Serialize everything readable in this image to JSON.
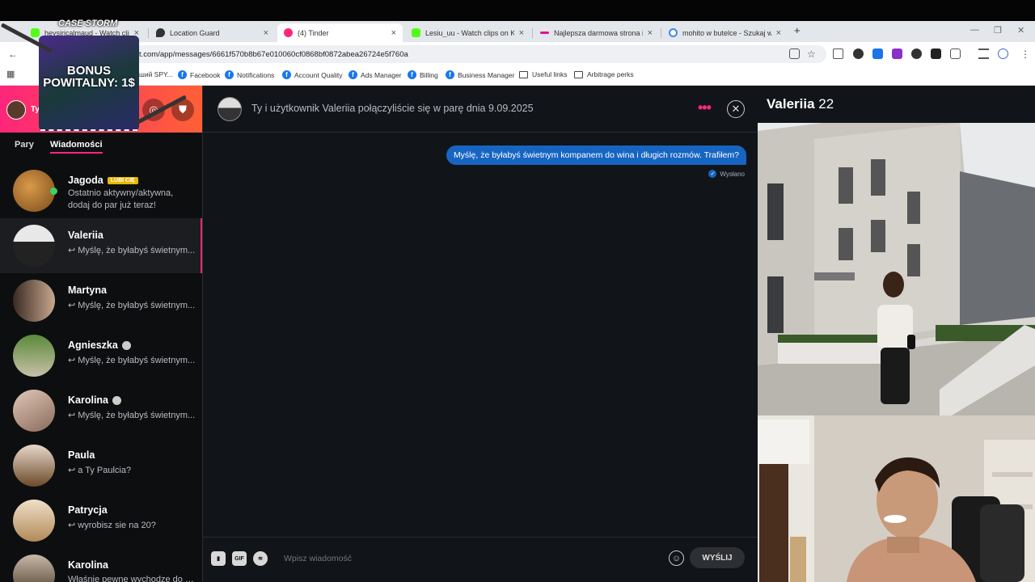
{
  "browser": {
    "tabs": [
      {
        "title": "heysiricalmaud - Watch clips",
        "color": "#53fc18"
      },
      {
        "title": "Location Guard",
        "color": "#333333"
      },
      {
        "title": "(4) Tinder",
        "color": "#fd267a"
      },
      {
        "title": "Lesiu_uu - Watch clips on Kick",
        "color": "#53fc18"
      },
      {
        "title": "Najlepsza darmowa strona i ap",
        "color": "#e0109a"
      },
      {
        "title": "mohito w butelce - Szukaj w Go",
        "color": "#4285f4"
      }
    ],
    "url": "t.com/app/messages/6661f570b8b67e010060cf0868bf0872abea26724e5f760a",
    "bookmarks": [
      {
        "label": "ший SPY...",
        "icon": "generic-icon"
      },
      {
        "label": "Facebook",
        "icon": "facebook-icon"
      },
      {
        "label": "Notifications",
        "icon": "facebook-icon"
      },
      {
        "label": "Account Quality",
        "icon": "facebook-icon"
      },
      {
        "label": "Ads Manager",
        "icon": "facebook-icon"
      },
      {
        "label": "Billing",
        "icon": "facebook-icon"
      },
      {
        "label": "Business Manager",
        "icon": "facebook-icon"
      },
      {
        "label": "Useful links",
        "icon": "folder-icon"
      },
      {
        "label": "Arbitrage perks",
        "icon": "folder-icon"
      }
    ]
  },
  "promo": {
    "brand": "CASE STORM",
    "text": "BONUS POWITALNY: 1$"
  },
  "sidebar": {
    "user_name": "Ty",
    "tabs": {
      "matches": "Pary",
      "messages": "Wiadomości"
    },
    "conversations": [
      {
        "name": "Jagoda",
        "badge": "LUBI CIĘ",
        "preview": "Ostatnio aktywny/aktywna, dodaj do par już teraz!",
        "avatar_color": "#b07a3a"
      },
      {
        "name": "Valeriia",
        "preview": "↩ Myślę, że byłabyś świetnym...",
        "avatar_color": "#d8d8d8"
      },
      {
        "name": "Martyna",
        "preview": "↩ Myślę, że byłabyś świetnym...",
        "avatar_color": "#6b5a4e"
      },
      {
        "name": "Agnieszka",
        "preview": "↩ Myślę, że byłabyś świetnym...",
        "avatar_color": "#4a7a3a"
      },
      {
        "name": "Karolina",
        "preview": "↩ Myślę, że byłabyś świetnym...",
        "avatar_color": "#9a7a6a"
      },
      {
        "name": "Paula",
        "preview": "↩ a Ty Paulcia?",
        "avatar_color": "#8a6a4a"
      },
      {
        "name": "Patrycja",
        "preview": "↩ wyrobisz sie na 20?",
        "avatar_color": "#a88a6a"
      },
      {
        "name": "Karolina",
        "preview": "Właśnie pewne wychodze do g...",
        "avatar_color": "#7a6a5a"
      }
    ]
  },
  "chat": {
    "header": "Ty i użytkownik Valeriia połączyliście się w parę dnia 9.09.2025",
    "message": "Myślę, że byłabyś świetnym kompanem do wina i długich rozmów. Trafiłem?",
    "status": "Wysłano",
    "input_placeholder": "Wpisz wiadomość",
    "send_label": "WYŚLIJ",
    "gif_label": "GIF"
  },
  "profile": {
    "name": "Valeriia",
    "age": "22"
  },
  "colors": {
    "tinder_pink": "#fd267a",
    "tinder_orange": "#ff6036",
    "message_blue": "#1765c2"
  }
}
